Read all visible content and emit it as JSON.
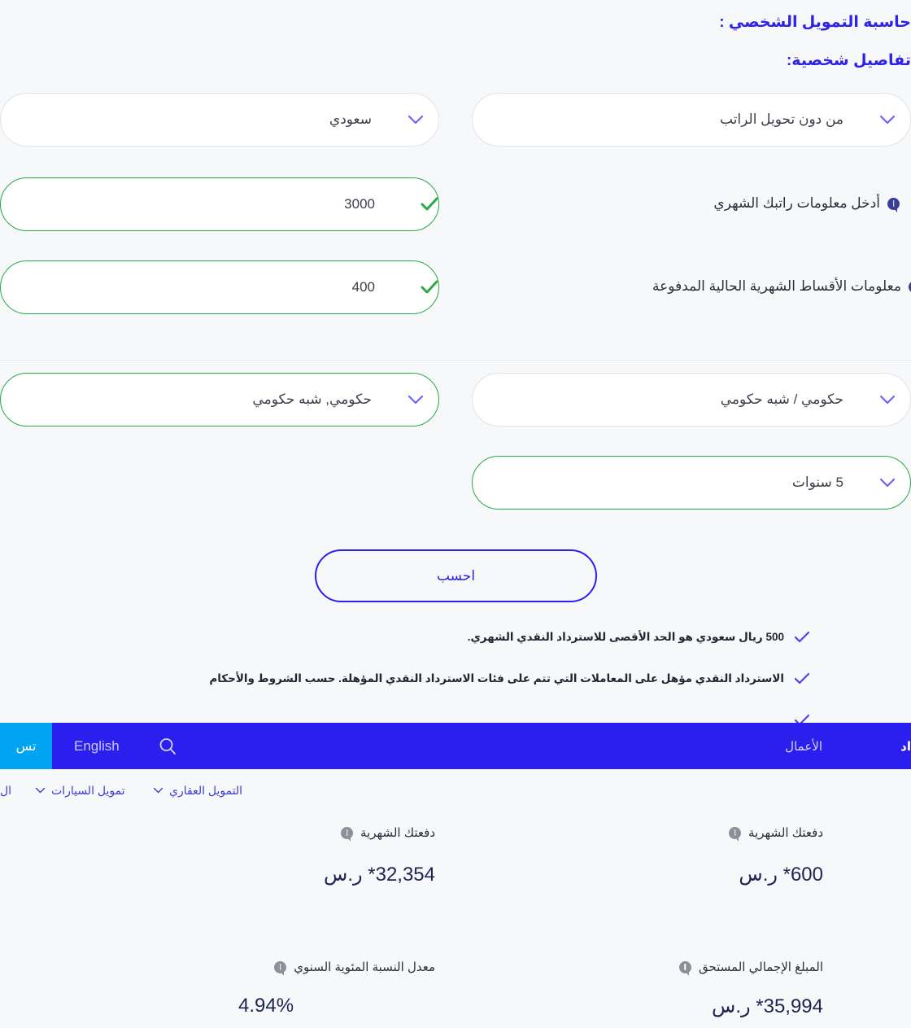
{
  "calculator": {
    "title": "حاسبة التمويل الشخصي :",
    "subtitle": "تفاصيل شخصية:",
    "fields": {
      "salary_transfer": {
        "value": "من دون تحويل الراتب"
      },
      "nationality": {
        "value": "سعودي"
      },
      "monthly_salary": {
        "label": "أدخل معلومات راتبك الشهري",
        "value": "3000"
      },
      "current_installments": {
        "label": "معلومات الأقساط الشهرية الحالية المدفوعة",
        "value": "400"
      },
      "employer_sector": {
        "value": "حكومي / شبه حكومي"
      },
      "employer_sector_detail": {
        "value": "حكومي, شبه حكومي"
      },
      "tenure": {
        "value": "5 سنوات"
      }
    },
    "calculate_button": "احسب",
    "notes": [
      "500 ريال سعودي هو الحد الأقصى للاسترداد النقدي الشهري.",
      "الاسترداد النقدي مؤهل على المعاملات التي تتم على فئات الاسترداد النقدي المؤهلة. حسب الشروط والأحكام"
    ]
  },
  "navbar": {
    "cyan_button": "تس",
    "english_link": "English",
    "search_icon": "search-icon",
    "items_right": [
      "الأعمال",
      "اد"
    ]
  },
  "subnav": {
    "items": [
      {
        "label": "التمويل العقاري",
        "chevron": true
      },
      {
        "label": "تمويل السيارات",
        "chevron": true
      },
      {
        "label": "ال",
        "chevron": false
      }
    ]
  },
  "results": [
    {
      "label": "دفعتك الشهرية",
      "value": "600* ر.س"
    },
    {
      "label": "دفعتك الشهرية",
      "value": "32,354* ر.س"
    },
    {
      "label": "المبلغ الإجمالي المستحق",
      "value": "35,994* ر.س"
    },
    {
      "label": "معدل النسبة المئوية السنوي",
      "value": "4.94%"
    }
  ],
  "colors": {
    "brand_blue": "#2b1ff0",
    "accent_cyan": "#00a3f0",
    "valid_green": "#2aa84a",
    "text_dark": "#2b2f38",
    "value_navy": "#1e2450"
  }
}
